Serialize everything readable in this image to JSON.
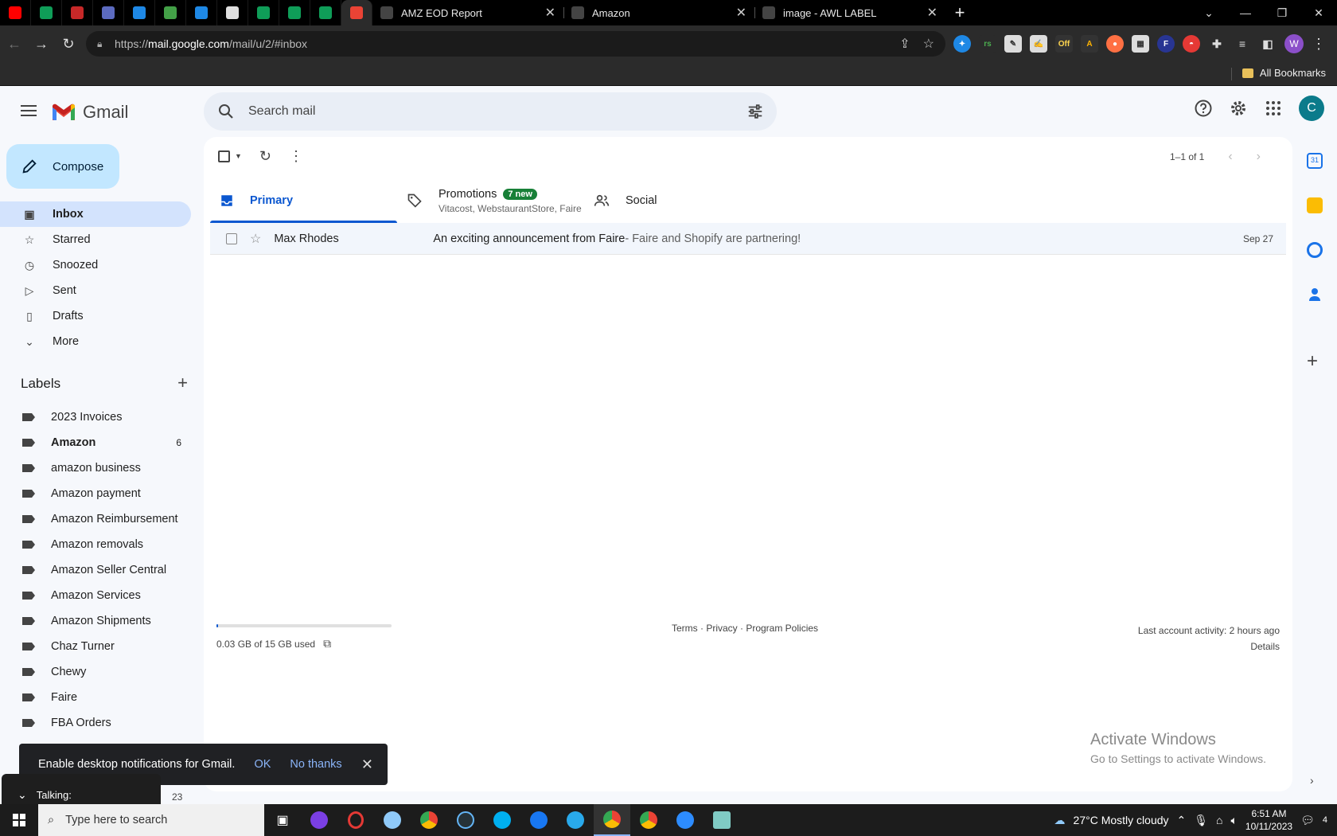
{
  "browser": {
    "pinned_tabs": [
      {
        "icon": "youtube-icon",
        "color": "#ff0000"
      },
      {
        "icon": "sheets-icon",
        "color": "#0f9d58"
      },
      {
        "icon": "w-icon",
        "color": "#c62828"
      },
      {
        "icon": "card-icon",
        "color": "#5c6bc0"
      },
      {
        "icon": "gear-blue-icon",
        "color": "#1e88e5"
      },
      {
        "icon": "leaf-icon",
        "color": "#43a047"
      },
      {
        "icon": "gear-blue-icon",
        "color": "#1e88e5"
      },
      {
        "icon": "grid-icon",
        "color": "#e0e0e0"
      },
      {
        "icon": "sheets-icon",
        "color": "#0f9d58"
      },
      {
        "icon": "sheets-icon",
        "color": "#0f9d58"
      },
      {
        "icon": "sheets-icon",
        "color": "#0f9d58"
      },
      {
        "icon": "gmail-icon",
        "color": "#ea4335"
      }
    ],
    "tabs": [
      {
        "title": "AMZ EOD Report",
        "icon": "report-icon"
      },
      {
        "title": "Amazon",
        "icon": "amazon-icon"
      },
      {
        "title": "image - AWL LABEL",
        "icon": "label-icon"
      }
    ],
    "url_prefix": "https://",
    "url_host": "mail.google.com",
    "url_path": "/mail/u/2/#inbox",
    "profile_initial": "W",
    "bookmarks_label": "All Bookmarks"
  },
  "gmail": {
    "product_name": "Gmail",
    "search_placeholder": "Search mail",
    "account_initial": "C",
    "compose_label": "Compose",
    "nav": [
      {
        "label": "Inbox",
        "icon": "inbox-icon",
        "active": true
      },
      {
        "label": "Starred",
        "icon": "star-icon"
      },
      {
        "label": "Snoozed",
        "icon": "clock-icon"
      },
      {
        "label": "Sent",
        "icon": "send-icon"
      },
      {
        "label": "Drafts",
        "icon": "draft-icon"
      },
      {
        "label": "More",
        "icon": "chevron-down-icon"
      }
    ],
    "labels_title": "Labels",
    "labels": [
      {
        "name": "2023 Invoices"
      },
      {
        "name": "Amazon",
        "count": "6",
        "bold": true
      },
      {
        "name": "amazon business"
      },
      {
        "name": "Amazon payment"
      },
      {
        "name": "Amazon Reimbursement"
      },
      {
        "name": "Amazon removals"
      },
      {
        "name": "Amazon Seller Central"
      },
      {
        "name": "Amazon Services"
      },
      {
        "name": "Amazon Shipments"
      },
      {
        "name": "Chaz Turner"
      },
      {
        "name": "Chewy"
      },
      {
        "name": "Faire"
      },
      {
        "name": "FBA Orders"
      }
    ],
    "pager_text": "1–1 of 1",
    "category_tabs": {
      "primary": "Primary",
      "promotions": "Promotions",
      "promotions_badge": "7 new",
      "promotions_senders": "Vitacost, WebstaurantStore, Faire",
      "social": "Social"
    },
    "emails": [
      {
        "sender": "Max Rhodes",
        "subject": "An exciting announcement from Faire",
        "snippet": " - Faire and Shopify are partnering!",
        "date": "Sep 27"
      }
    ],
    "storage": {
      "used_text": "0.03 GB of 15 GB used",
      "used_fraction": 0.002
    },
    "footer_links": "Terms · Privacy · Program Policies",
    "last_activity": "Last account activity: 2 hours ago",
    "details": "Details",
    "notification": {
      "text": "Enable desktop notifications for Gmail.",
      "ok": "OK",
      "no_thanks": "No thanks"
    },
    "talking_label": "Talking:",
    "partial_count": "23"
  },
  "windows": {
    "activate_title": "Activate Windows",
    "activate_sub": "Go to Settings to activate Windows.",
    "search_placeholder": "Type here to search",
    "weather": "27°C  Mostly cloudy",
    "time": "6:51 AM",
    "date": "10/11/2023",
    "notification_count": "4"
  }
}
